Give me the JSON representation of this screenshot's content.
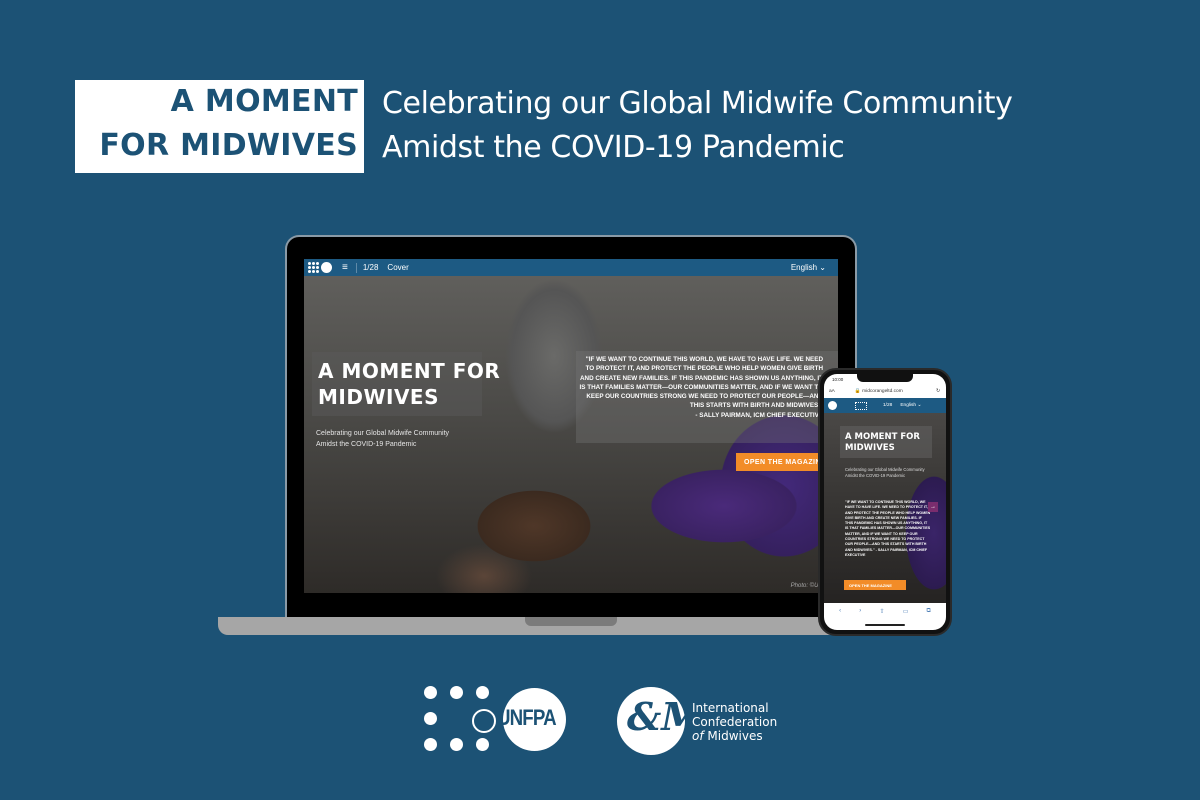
{
  "header": {
    "title_line1": "A MOMENT",
    "title_line2": "FOR MIDWIVES",
    "subtitle_line1": "Celebrating our Global Midwife Community",
    "subtitle_line2": "Amidst the COVID-19 Pandemic"
  },
  "laptop": {
    "topbar": {
      "menu_icon": "≡",
      "page": "1/28",
      "section": "Cover",
      "language": "English ⌄"
    },
    "hero": {
      "title_line1": "A MOMENT FOR",
      "title_line2": "MIDWIVES",
      "sub_line1": "Celebrating our Global Midwife Community",
      "sub_line2": "Amidst the COVID-19 Pandemic"
    },
    "quote": "\"IF WE WANT TO CONTINUE THIS WORLD, WE HAVE TO HAVE LIFE. WE NEED TO PROTECT IT, AND PROTECT THE PEOPLE WHO HELP WOMEN GIVE BIRTH AND CREATE NEW FAMILIES. IF THIS PANDEMIC HAS SHOWN US ANYTHING, IT IS THAT FAMILIES MATTER—OUR COMMUNITIES MATTER, AND IF WE WANT TO KEEP OUR COUNTRIES STRONG WE NEED TO PROTECT OUR PEOPLE—AND THIS STARTS WITH BIRTH AND MIDWIVES.\"",
    "quote_attribution": "- SALLY PAIRMAN, ICM CHIEF EXECUTIVE",
    "open_button": "OPEN THE MAGAZINE",
    "photo_credit": "Photo: ©UNFPA"
  },
  "phone": {
    "status_time": "10:00",
    "url_aa": "aA",
    "url": "🔒 midcorangeltd.com",
    "reload_icon": "↻",
    "page": "1/28",
    "language": "English ⌄",
    "hero_title_line1": "A MOMENT FOR",
    "hero_title_line2": "MIDWIVES",
    "hero_sub": "Celebrating our Global Midwife Community Amidst the COVID-19 Pandemic",
    "quote": "\"IF WE WANT TO CONTINUE THIS WORLD, WE HAVE TO HAVE LIFE. WE NEED TO PROTECT IT, AND PROTECT THE PEOPLE WHO HELP WOMEN GIVE BIRTH AND CREATE NEW FAMILIES. IF THIS PANDEMIC HAS SHOWN US ANYTHING, IT IS THAT FAMILIES MATTER—OUR COMMUNITIES MATTER, AND IF WE WANT TO KEEP OUR COUNTRIES STRONG WE NEED TO PROTECT OUR PEOPLE—AND THIS STARTS WITH BIRTH AND MIDWIVES.\" - SALLY PAIRMAN, ICM CHIEF EXECUTIVE",
    "arrow": "→",
    "open_button": "OPEN THE MAGAZINE",
    "toolbar": {
      "back": "‹",
      "forward": "›",
      "share": "⇧",
      "bookmarks": "▭",
      "tabs": "⧉"
    }
  },
  "logos": {
    "unfpa_label": "UNFPA",
    "un_emblem": "🌐",
    "icm_glyph": "&M",
    "icm_line1": "International",
    "icm_line2": "Confederation",
    "icm_line3_italic": "of",
    "icm_line3_rest": " Midwives"
  },
  "colors": {
    "background": "#1c5275",
    "accent_orange": "#f28c28",
    "nav_blue": "#1d5a83"
  }
}
